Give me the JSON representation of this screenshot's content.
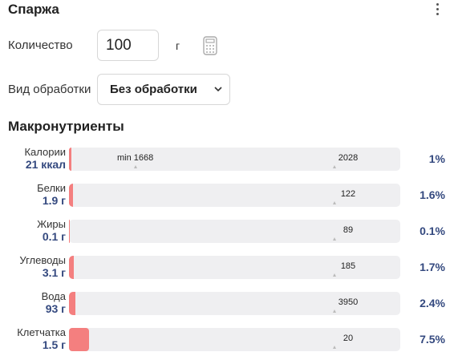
{
  "food": {
    "title": "Спаржа"
  },
  "quantity": {
    "label": "Количество",
    "value": "100",
    "unit": "г"
  },
  "processing": {
    "label": "Вид обработки",
    "selected": "Без обработки"
  },
  "macros": {
    "title": "Макронутриенты",
    "rows": [
      {
        "name": "Калории",
        "amount": "21 ккал",
        "min_label": "min 1668",
        "recommended": "2028",
        "percent": "1%",
        "fill_percent": 1
      },
      {
        "name": "Белки",
        "amount": "1.9 г",
        "recommended": "122",
        "percent": "1.6%",
        "fill_percent": 1.6
      },
      {
        "name": "Жиры",
        "amount": "0.1 г",
        "recommended": "89",
        "percent": "0.1%",
        "fill_percent": 0.1
      },
      {
        "name": "Углеводы",
        "amount": "3.1 г",
        "recommended": "185",
        "percent": "1.7%",
        "fill_percent": 1.7
      },
      {
        "name": "Вода",
        "amount": "93 г",
        "recommended": "3950",
        "percent": "2.4%",
        "fill_percent": 2.4
      },
      {
        "name": "Клетчатка",
        "amount": "1.5 г",
        "recommended": "20",
        "percent": "7.5%",
        "fill_percent": 7.5
      }
    ]
  },
  "colors": {
    "accent": "#34497f",
    "bar_fill": "#f47f7f",
    "track": "#efeff1"
  }
}
